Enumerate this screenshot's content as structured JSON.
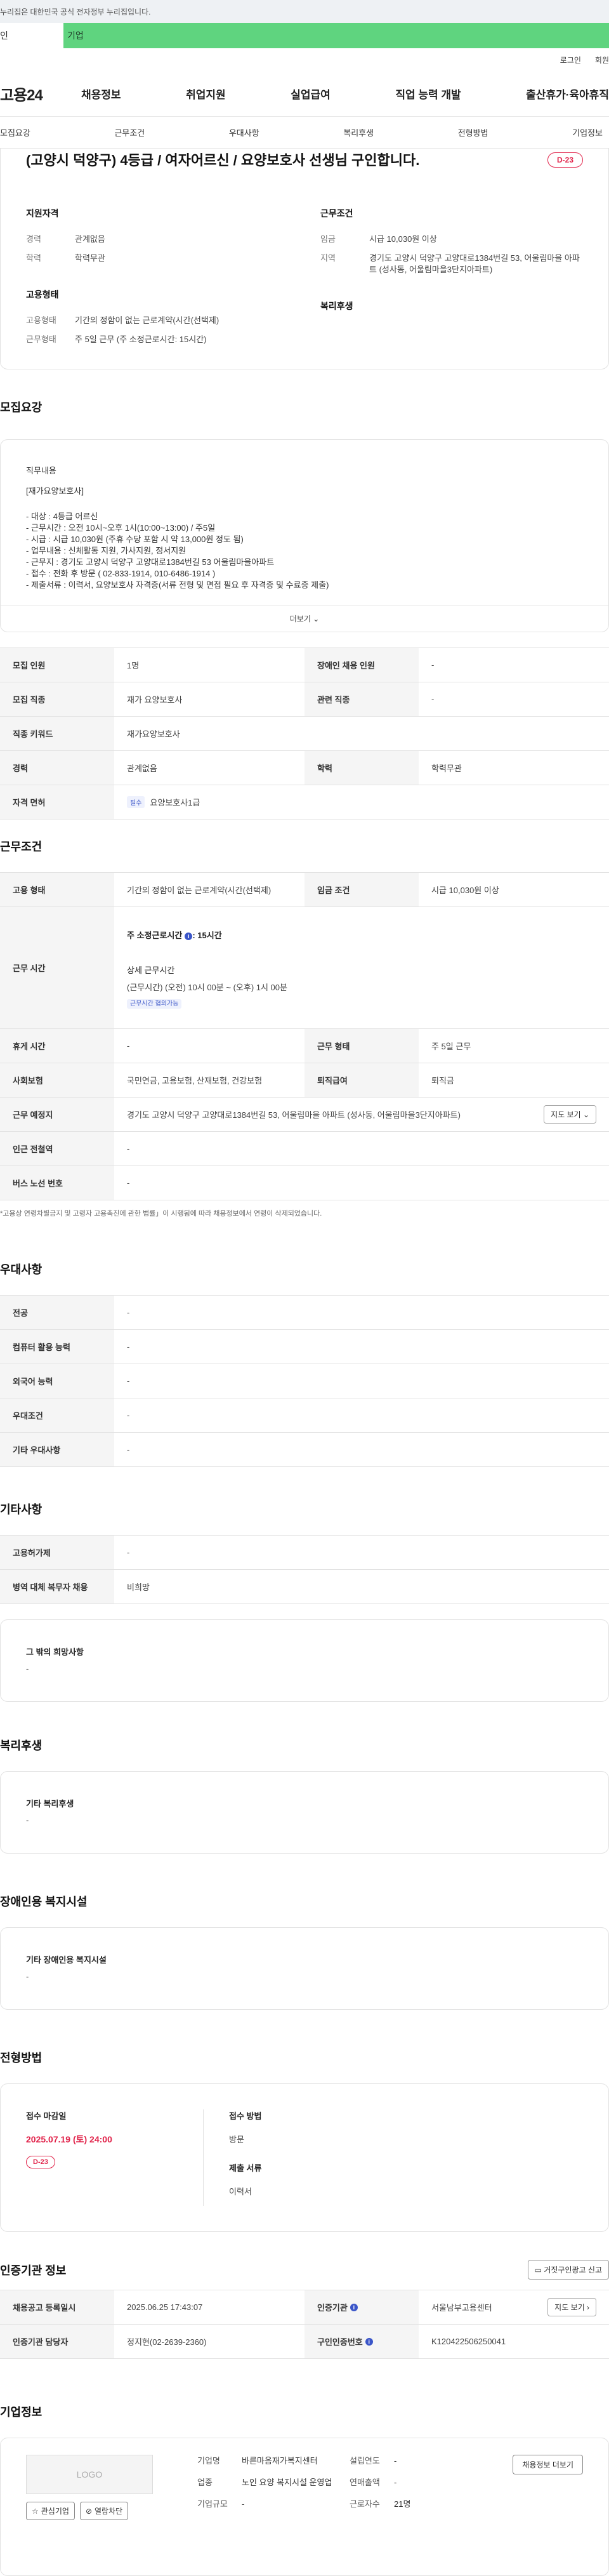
{
  "banner": {
    "text": "누리집은 대한민국 공식 전자정부 누리집입니다."
  },
  "usertype": {
    "personal": "인",
    "company": "기업"
  },
  "util": {
    "login": "로그인",
    "join": "회원"
  },
  "gnb": {
    "logo": "고용24",
    "menu": [
      "채용정보",
      "취업지원",
      "실업급여",
      "직업 능력 개발",
      "출산휴가·육아휴직"
    ]
  },
  "subtabs": [
    "모집요강",
    "근무조건",
    "우대사항",
    "복리후생",
    "전형방법",
    "기업정보"
  ],
  "summary": {
    "title": "(고양시 덕양구) 4등급 / 여자어르신 / 요양보호사 선생님 구인합니다.",
    "dday": "D-23",
    "qualification": {
      "heading": "지원자격",
      "career_k": "경력",
      "career_v": "관계없음",
      "edu_k": "학력",
      "edu_v": "학력무관"
    },
    "conditions": {
      "heading": "근무조건",
      "wage_k": "임금",
      "wage_v": "시급 10,030원 이상",
      "region_k": "지역",
      "region_v": "경기도 고양시 덕양구 고양대로1384번길 53, 어울림마을 아파트 (성사동, 어울림마을3단지아파트)"
    },
    "employment": {
      "heading": "고용형태",
      "type_k": "고용형태",
      "type_v": "기간의 정함이 없는 근로계약(시간(선택제)",
      "work_k": "근무형태",
      "work_v": "주 5일 근무 (주 소정근로시간: 15시간)"
    },
    "welfare": {
      "heading": "복리후생"
    }
  },
  "recruit": {
    "title": "모집요강",
    "content_heading": "직무내용",
    "content_sub": "[재가요양보호사]",
    "lines": [
      "- 대상 : 4등급 어르신",
      "- 근무시간 : 오전 10시~오후 1시(10:00~13:00) / 주5일",
      "- 시급 : 시급 10,030원 (주휴 수당 포함 시 약 13,000원 정도 됨)",
      "- 업무내용 : 신체활동 지원, 가사지원, 정서지원",
      "- 근무지 : 경기도 고양시 덕양구 고양대로1384번길 53 어울림마을아파트",
      "- 접수 : 전화 후 방문 ( 02-833-1914, 010-6486-1914 )",
      "- 제출서류 : 이력서, 요양보호사 자격증(서류 전형 및 면접 필요 후 자격증 및 수료증 제출)"
    ],
    "more": "더보기",
    "rows": [
      [
        {
          "k": "모집 인원",
          "v": "1명"
        },
        {
          "k": "장애인 채용 인원",
          "v": "-"
        }
      ],
      [
        {
          "k": "모집 직종",
          "v": "재가 요양보호사"
        },
        {
          "k": "관련 직종",
          "v": "-"
        }
      ],
      [
        {
          "k": "직종 키워드",
          "v": "재가요양보호사"
        }
      ],
      [
        {
          "k": "경력",
          "v": "관계없음"
        },
        {
          "k": "학력",
          "v": "학력무관"
        }
      ],
      [
        {
          "k": "자격 면허",
          "tag": "필수",
          "v": "요양보호사1급"
        }
      ]
    ]
  },
  "work": {
    "title": "근무조건",
    "type_k": "고용 형태",
    "type_v": "기간의 정함이 없는 근로계약(시간(선택제)",
    "wage_k": "임금 조건",
    "wage_v": "시급 10,030원 이상",
    "hours_k": "근무 시간",
    "weekly_label": "주 소정근로시간",
    "weekly_value": ": 15시간",
    "detail_label": "상세 근무시간",
    "detail_value": "(근무시간) (오전) 10시 00분 ~ (오후) 1시 00분",
    "negotiable": "근무시간 협의가능",
    "rest_k": "휴게 시간",
    "rest_v": "-",
    "form_k": "근무 형태",
    "form_v": "주 5일 근무",
    "insurance_k": "사회보험",
    "insurance_v": "국민연금, 고용보험, 산재보험, 건강보험",
    "retire_k": "퇴직급여",
    "retire_v": "퇴직금",
    "place_k": "근무 예정지",
    "place_v": "경기도 고양시 덕양구 고양대로1384번길 53, 어울림마을 아파트 (성사동, 어울림마을3단지아파트)",
    "map_btn": "지도 보기",
    "subway_k": "인근 전철역",
    "subway_v": "-",
    "bus_k": "버스 노선 번호",
    "bus_v": "-",
    "note": "*고용상 연령차별금지 및 고령자 고용촉진에 관한 법률」이 시행됨에 따라 채용정보에서 연령이 삭제되었습니다."
  },
  "pref": {
    "title": "우대사항",
    "rows": [
      {
        "k": "전공",
        "v": "-"
      },
      {
        "k": "컴퓨터 활용 능력",
        "v": "-"
      },
      {
        "k": "외국어 능력",
        "v": "-"
      },
      {
        "k": "우대조건",
        "v": "-"
      },
      {
        "k": "기타 우대사항",
        "v": "-"
      }
    ]
  },
  "etc": {
    "title": "기타사항",
    "rows": [
      {
        "k": "고용허가제",
        "v": "-"
      },
      {
        "k": "병역 대체 복무자 채용",
        "v": "비희망"
      }
    ],
    "other_label": "그 밖의 희망사항",
    "other_value": "-"
  },
  "welfare": {
    "title": "복리후생",
    "label": "기타 복리후생",
    "value": "-"
  },
  "disability": {
    "title": "장애인용 복지시설",
    "label": "기타 장애인용 복지시설",
    "value": "-"
  },
  "process": {
    "title": "전형방법",
    "deadline_label": "접수 마감일",
    "deadline_value": "2025.07.19 (토) 24:00",
    "dday": "D-23",
    "method_label": "접수 방법",
    "method_value": "방문",
    "docs_label": "제출 서류",
    "docs_value": "이력서"
  },
  "cert": {
    "title": "인증기관 정보",
    "report_btn": "거짓구인광고 신고",
    "reg_k": "채용공고 등록일시",
    "reg_v": "2025.06.25 17:43:07",
    "org_k": "인증기관",
    "org_v": "서울남부고용센터",
    "map_btn": "지도 보기",
    "mgr_k": "인증기관 담당자",
    "mgr_v": "정지현(02-2639-2360)",
    "num_k": "구인인증번호",
    "num_v": "K120422506250041"
  },
  "company": {
    "title": "기업정보",
    "logo": "LOGO",
    "fav_btn": "관심기업",
    "block_btn": "열람차단",
    "name_k": "기업명",
    "name_v": "바른마음재가복지센터",
    "industry_k": "업종",
    "industry_v": "노인 요양 복지시설 운영업",
    "size_k": "기업규모",
    "size_v": "-",
    "founded_k": "설립연도",
    "founded_v": "-",
    "sales_k": "연매출액",
    "sales_v": "-",
    "staff_k": "근로자수",
    "staff_v": "21명",
    "jobs_btn": "채용정보 더보기"
  }
}
